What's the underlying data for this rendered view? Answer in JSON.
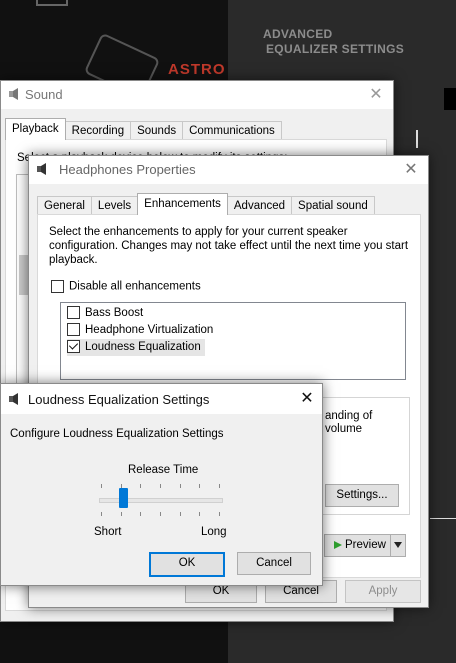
{
  "background_app": {
    "heading_line1": "ADVANCED",
    "heading_line2": "EQUALIZER SETTINGS",
    "brand": "ASTRO"
  },
  "sound_window": {
    "title": "Sound",
    "tabs": [
      "Playback",
      "Recording",
      "Sounds",
      "Communications"
    ],
    "active_tab": "Playback",
    "instruction": "Select a playback device below to modify its settings:"
  },
  "props_window": {
    "title": "Headphones Properties",
    "tabs": [
      "General",
      "Levels",
      "Enhancements",
      "Advanced",
      "Spatial sound"
    ],
    "active_tab": "Enhancements",
    "description": "Select the enhancements to apply for your current speaker configuration. Changes may not take effect until the next time you start playback.",
    "disable_all_label": "Disable all enhancements",
    "disable_all_checked": false,
    "enhancements": [
      {
        "label": "Bass Boost",
        "checked": false
      },
      {
        "label": "Headphone Virtualization",
        "checked": false
      },
      {
        "label": "Loudness Equalization",
        "checked": true
      }
    ],
    "properties_text_line1": "anding of",
    "properties_text_line2": "volume",
    "settings_button": "Settings...",
    "preview_button": "Preview",
    "ok_button": "OK",
    "cancel_button": "Cancel",
    "apply_button": "Apply"
  },
  "loudness_dialog": {
    "title": "Loudness Equalization Settings",
    "configure_label": "Configure Loudness Equalization Settings",
    "release_time_label": "Release Time",
    "slider_min_label": "Short",
    "slider_max_label": "Long",
    "slider_value_fraction": 0.2,
    "ok_button": "OK",
    "cancel_button": "Cancel"
  },
  "colors": {
    "accent": "#0078d7",
    "brand_red": "#c0392b",
    "preview_green": "#2e9e2e"
  }
}
